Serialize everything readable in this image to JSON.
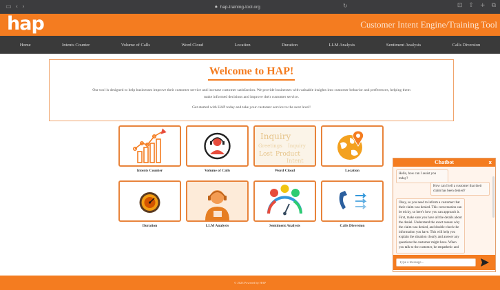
{
  "browser": {
    "url": "hap-training-tool.org"
  },
  "header": {
    "logo": "hap",
    "title": "Customer Intent Engine/Training Tool"
  },
  "nav": {
    "items": [
      {
        "label": "Home"
      },
      {
        "label": "Intents Counter"
      },
      {
        "label": "Volume of Calls"
      },
      {
        "label": "Word Cloud"
      },
      {
        "label": "Location"
      },
      {
        "label": "Duration"
      },
      {
        "label": "LLM Analysis"
      },
      {
        "label": "Sentiment Analysis"
      },
      {
        "label": "Calls Diversion"
      }
    ]
  },
  "welcome": {
    "title": "Welcome to HAP!",
    "description": "Our tool is designed to help businesses improve their customer service and increase customer satisfaction. We provide businesses with valuable insights into customer behavior and preferences, helping them make informed decisions and improve their customer service.",
    "cta": "Get started with HAP today and take your customer service to the next level!"
  },
  "tiles": [
    {
      "label": "Intents Counter",
      "icon": "bar-chart-growth-icon"
    },
    {
      "label": "Volume of Calls",
      "icon": "call-center-agent-icon"
    },
    {
      "label": "Word Cloud",
      "icon": "word-cloud-icon"
    },
    {
      "label": "Location",
      "icon": "globe-location-pin-icon"
    },
    {
      "label": "Duration",
      "icon": "gauge-dial-icon"
    },
    {
      "label": "LLM Analysis",
      "icon": "headset-person-icon"
    },
    {
      "label": "Sentiment Analysis",
      "icon": "sentiment-emoji-icon"
    },
    {
      "label": "Calls Diversion",
      "icon": "phone-transfer-icon"
    }
  ],
  "word_cloud_words": [
    "Inquiry",
    "Greetings",
    "Inquiry",
    "Lost",
    "Product",
    "Intent"
  ],
  "chatbot": {
    "title": "Chatbot",
    "close": "x",
    "messages": [
      {
        "from": "bot",
        "text": "Hello, how can I assist you today?"
      },
      {
        "from": "user",
        "text": "How can I tell a customer that their claim has been denied?"
      },
      {
        "from": "bot",
        "text": "Okay, so you need to inform a customer that their claim was denied. This conversation can be tricky, so here's how you can approach it. First, make sure you have all the details about the denial. Understand the exact reason why the claim was denied, and double-check the information you have. This will help you explain the situation clearly and answer any questions the customer might have. When you talk to the customer, be empathetic and"
      }
    ],
    "input_placeholder": "Type a message..."
  },
  "footer": {
    "text": "© 2023 Powered by HAP"
  },
  "colors": {
    "brand_orange": "#f47c20",
    "nav_bg": "#3a3a3a",
    "chrome_bg": "#3c3c3e"
  }
}
